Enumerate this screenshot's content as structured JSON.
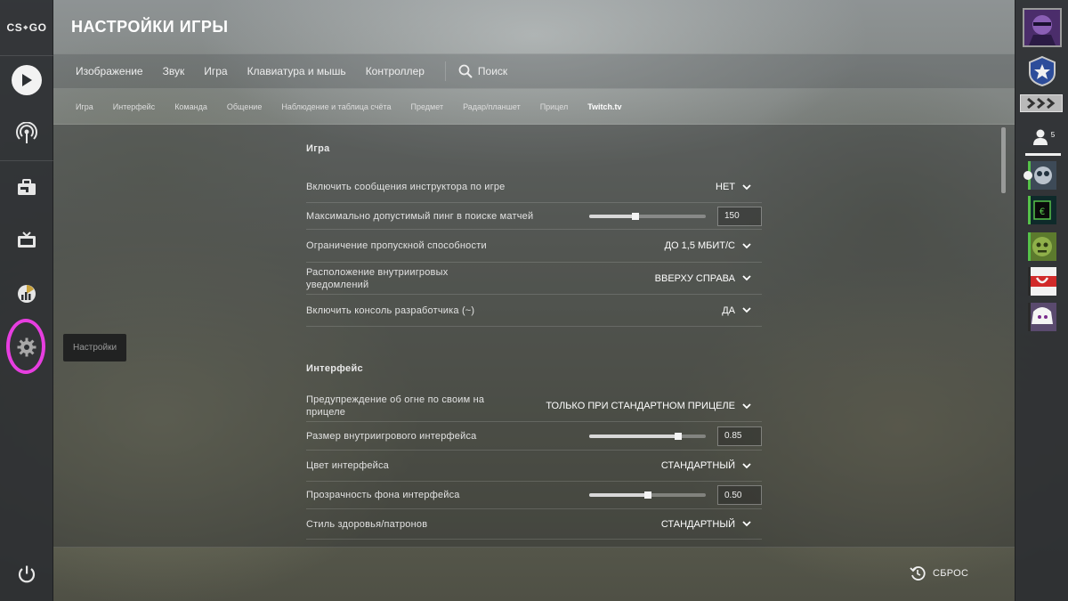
{
  "app": {
    "logo_left": "CS",
    "logo_right": "GO"
  },
  "sidebar_left": {
    "items": [
      {
        "icon": "play-icon"
      },
      {
        "icon": "broadcast-icon"
      },
      {
        "icon": "inventory-icon"
      },
      {
        "icon": "tv-icon"
      },
      {
        "icon": "stats-icon"
      },
      {
        "icon": "gear-icon"
      },
      {
        "icon": "power-icon"
      }
    ],
    "tooltip": "Настройки"
  },
  "header": {
    "title": "НАСТРОЙКИ ИГРЫ"
  },
  "tabs_main": [
    "Изображение",
    "Звук",
    "Игра",
    "Клавиатура и мышь",
    "Контроллер"
  ],
  "search": {
    "label": "Поиск"
  },
  "tabs_sub": [
    "Игра",
    "Интерфейс",
    "Команда",
    "Общение",
    "Наблюдение и таблица счёта",
    "Предмет",
    "Радар/планшет",
    "Прицел",
    "Twitch.tv"
  ],
  "sections": {
    "game": {
      "title": "Игра",
      "rows": [
        {
          "label": "Включить сообщения инструктора по игре",
          "value": "НЕТ"
        },
        {
          "label": "Максимально допустимый пинг в поиске матчей",
          "value": "150",
          "slider": 0.4
        },
        {
          "label": "Ограничение пропускной способности",
          "value": "ДО 1,5 МБИТ/С"
        },
        {
          "label": "Расположение внутриигровых уведомлений",
          "value": "ВВЕРХУ СПРАВА"
        },
        {
          "label": "Включить консоль разработчика (~)",
          "value": "ДА"
        }
      ]
    },
    "interface": {
      "title": "Интерфейс",
      "rows": [
        {
          "label": "Предупреждение об огне по своим на прицеле",
          "value": "ТОЛЬКО ПРИ СТАНДАРТНОМ ПРИЦЕЛЕ"
        },
        {
          "label": "Размер внутриигрового интерфейса",
          "value": "0.85",
          "slider": 0.76
        },
        {
          "label": "Цвет интерфейса",
          "value": "СТАНДАРТНЫЙ"
        },
        {
          "label": "Прозрачность фона интерфейса",
          "value": "0.50",
          "slider": 0.5
        },
        {
          "label": "Стиль здоровья/патронов",
          "value": "СТАНДАРТНЫЙ"
        }
      ]
    }
  },
  "footer": {
    "reset_label": "СБРОС"
  },
  "sidebar_right": {
    "friend_count": "5"
  },
  "colors": {
    "highlight": "#e73ee0",
    "sidebar": "#2c2f32",
    "text": "#e6e6e6"
  }
}
